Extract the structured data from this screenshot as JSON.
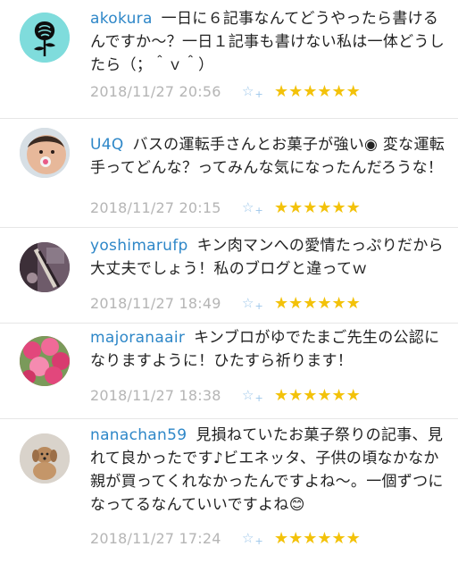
{
  "comments": [
    {
      "user": "akokura",
      "text": "一日に６記事なんてどうやったら書けるんですか〜？一日１記事も書けない私は一体どうしたら（；＾ｖ＾）",
      "date": "2018/11/27 20:56",
      "add_star_icon": "add-star-icon",
      "stars": "★★★★★★",
      "avatar": "rose-icon"
    },
    {
      "user": "U4Q",
      "text": "バスの運転手さんとお菓子が強い◉ 変な運転手ってどんな？ってみんな気になったんだろうな！",
      "date": "2018/11/27 20:15",
      "add_star_icon": "add-star-icon",
      "stars": "★★★★★★",
      "avatar": "baby-photo"
    },
    {
      "user": "yoshimarufp",
      "text": "キン肉マンへの愛情たっぷりだから大丈夫でしょう！私のブログと違ってｗ",
      "date": "2018/11/27 18:49",
      "add_star_icon": "add-star-icon",
      "stars": "★★★★★★",
      "avatar": "guitar-photo"
    },
    {
      "user": "majoranaair",
      "text": "キンブロがゆでたまご先生の公認になりますように！ひたすら祈ります！",
      "date": "2018/11/27 18:38",
      "add_star_icon": "add-star-icon",
      "stars": "★★★★★★",
      "avatar": "roses-photo"
    },
    {
      "user": "nanachan59",
      "text": "見損ねていたお菓子祭りの記事、見れて良かったです♪ビエネッタ、子供の頃なかなか親が買ってくれなかったんですよね〜。一個ずつになってるなんていいですよね😊",
      "date": "2018/11/27 17:24",
      "add_star_icon": "add-star-icon",
      "stars": "★★★★★★",
      "avatar": "dog-photo"
    }
  ]
}
